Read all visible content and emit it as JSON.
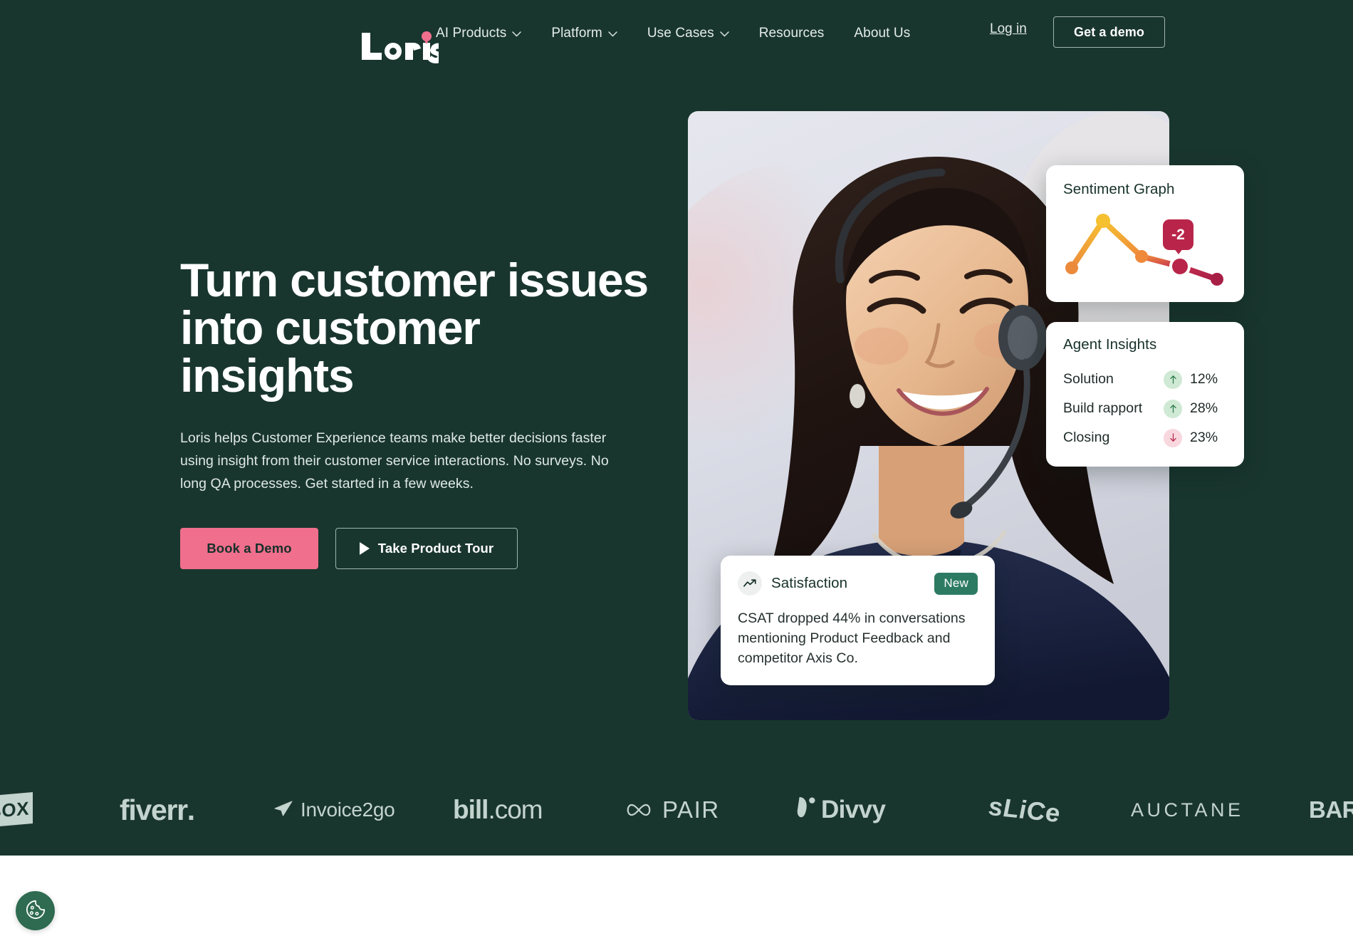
{
  "brand": {
    "name": "Loris",
    "logo_icon": "loris-wordmark",
    "accent_pink": "#f06f8d",
    "bg_dark_green": "#19362e",
    "badge_green": "#2d7a63"
  },
  "nav": {
    "items": [
      {
        "label": "AI Products",
        "has_chevron": true,
        "icon": "chevron-down-icon"
      },
      {
        "label": "Platform",
        "has_chevron": true,
        "icon": "chevron-down-icon"
      },
      {
        "label": "Use Cases",
        "has_chevron": true,
        "icon": "chevron-down-icon"
      },
      {
        "label": "Resources",
        "has_chevron": false,
        "icon": ""
      },
      {
        "label": "About Us",
        "has_chevron": false,
        "icon": ""
      }
    ],
    "login_label": "Log in",
    "demo_label": "Get a demo"
  },
  "hero": {
    "title": "Turn customer issues into customer insights",
    "subtitle": "Loris helps Customer Experience teams make better decisions faster using insight from their customer service interactions. No surveys. No long QA processes. Get started in a few weeks.",
    "primary_cta": "Book a Demo",
    "secondary_cta": "Take Product Tour",
    "secondary_cta_icon": "play-icon",
    "photo_alt": "Smiling customer service agent wearing a headset"
  },
  "cards": {
    "sentiment": {
      "title": "Sentiment Graph",
      "tooltip_value": "-2",
      "chart_data": {
        "type": "line",
        "title": "Sentiment Graph",
        "x": [
          1,
          2,
          3,
          4,
          5
        ],
        "values": [
          -0.5,
          1.6,
          -0.3,
          -1.1,
          -2.0
        ],
        "series": [
          {
            "name": "Sentiment",
            "values": [
              -0.5,
              1.6,
              -0.3,
              -1.1,
              -2.0
            ]
          }
        ],
        "point_colors": [
          "#ec8a3c",
          "#f5c131",
          "#ef8a3b",
          "#c32f4f",
          "#a81f46"
        ],
        "highlighted_index": 3,
        "highlight_label": "-2",
        "xlabel": "",
        "ylabel": "",
        "grid": false,
        "legend": "none"
      }
    },
    "agent_insights": {
      "title": "Agent Insights",
      "rows": [
        {
          "label": "Solution",
          "direction": "up",
          "icon": "arrow-up-icon",
          "value": "12%"
        },
        {
          "label": "Build rapport",
          "direction": "up",
          "icon": "arrow-up-icon",
          "value": "28%"
        },
        {
          "label": "Closing",
          "direction": "down",
          "icon": "arrow-down-icon",
          "value": "23%"
        }
      ]
    },
    "satisfaction": {
      "icon": "trend-up-icon",
      "title": "Satisfaction",
      "badge": "New",
      "body": "CSAT dropped 44% in conversations mentioning Product Feedback and competitor Axis Co."
    }
  },
  "logos": [
    {
      "name": "boxed-logo",
      "text": "BOX"
    },
    {
      "name": "fiverr-logo",
      "text": "fiverr"
    },
    {
      "name": "invoice2go-logo",
      "text": "Invoice2go"
    },
    {
      "name": "bill-com-logo",
      "text_bold": "bill",
      "text_light": ".com"
    },
    {
      "name": "pair-logo",
      "text": "PAIR"
    },
    {
      "name": "divvy-logo",
      "text": "Divvy"
    },
    {
      "name": "slice-logo",
      "text": "sLiCe"
    },
    {
      "name": "auctane-logo",
      "text": "AUCTANE"
    },
    {
      "name": "bark-logo",
      "text": "BARK"
    }
  ],
  "cookie": {
    "icon": "cookie-icon",
    "label": "Cookie settings"
  }
}
